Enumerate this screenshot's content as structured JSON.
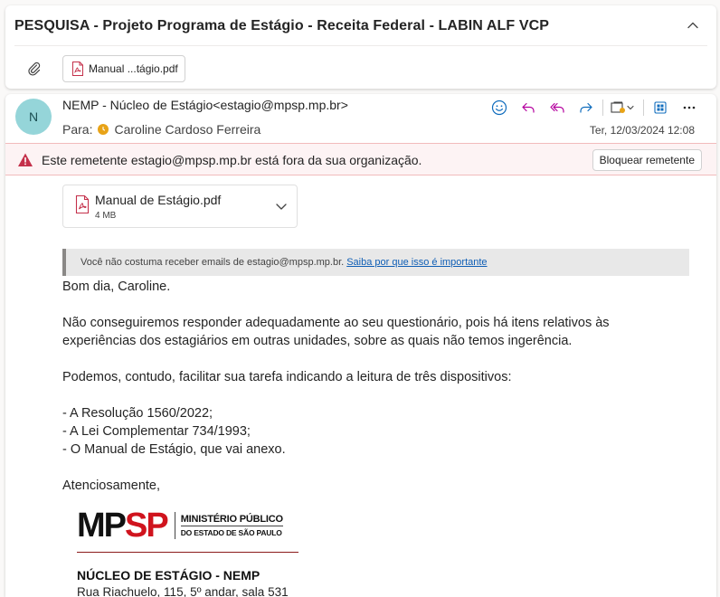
{
  "subject": "PESQUISA - Projeto Programa de Estágio - Receita Federal - LABIN ALF VCP",
  "header_attachment": {
    "name": "Manual ...tágio.pdf"
  },
  "message": {
    "avatar_initial": "N",
    "sender": "NEMP - Núcleo de Estágio<estagio@mpsp.mp.br>",
    "to_label": "Para:",
    "recipient": "Caroline Cardoso Ferreira",
    "date": "Ter, 12/03/2024 12:08"
  },
  "warning": {
    "text": "Este remetente estagio@mpsp.mp.br está fora da sua organização.",
    "block_button": "Bloquear remetente"
  },
  "attachment": {
    "name": "Manual de Estágio.pdf",
    "size": "4 MB"
  },
  "banner": {
    "text": "Você não costuma receber emails de estagio@mpsp.mp.br.",
    "link": "Saiba por que isso é importante"
  },
  "body": {
    "greeting": "Bom dia, Caroline.",
    "para1_line1": "Não conseguiremos responder adequadamente ao seu questionário, pois há itens relativos às",
    "para1_line2": "experiências dos estagiários em outras unidades, sobre as quais não temos ingerência.",
    "para2": "Podemos, contudo, facilitar sua tarefa indicando a leitura de três dispositivos:",
    "list": [
      "- A Resolução 1560/2022;",
      "- A Lei Complementar 734/1993;",
      "- O Manual de Estágio, que vai anexo."
    ],
    "closing": "Atenciosamente,"
  },
  "signature": {
    "logo_mp": "MP",
    "logo_sp": "SP",
    "logo_line1": "MINISTÉRIO PÚBLICO",
    "logo_line2": "DO ESTADO DE SÃO PAULO",
    "name": "NÚCLEO DE ESTÁGIO - NEMP",
    "address": "Rua Riachuelo, 115, 5º andar, sala 531"
  },
  "icons": {
    "collapse": "chevron-up-icon",
    "attach": "paperclip-icon",
    "pdf": "pdf-file-icon",
    "emoji": "smiley-icon",
    "reply": "reply-icon",
    "reply_all": "reply-all-icon",
    "forward": "forward-icon",
    "more": "more-icon",
    "warning": "warning-icon"
  },
  "colors": {
    "accent": "#0f6cbd",
    "warning_bg": "#fdf3f4",
    "warning_icon": "#c4314b",
    "avatar_bg": "#95d5d9",
    "pdf_red": "#c4314b",
    "logo_red": "#d0141e"
  }
}
